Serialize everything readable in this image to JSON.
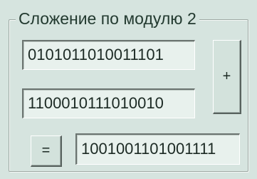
{
  "group": {
    "title": "Сложение по модулю 2"
  },
  "inputs": {
    "operand_a": "0101011010011101",
    "operand_b": "1100010111010010"
  },
  "buttons": {
    "add_label": "+",
    "equals_label": "="
  },
  "result": {
    "value": "1001001101001111"
  }
}
